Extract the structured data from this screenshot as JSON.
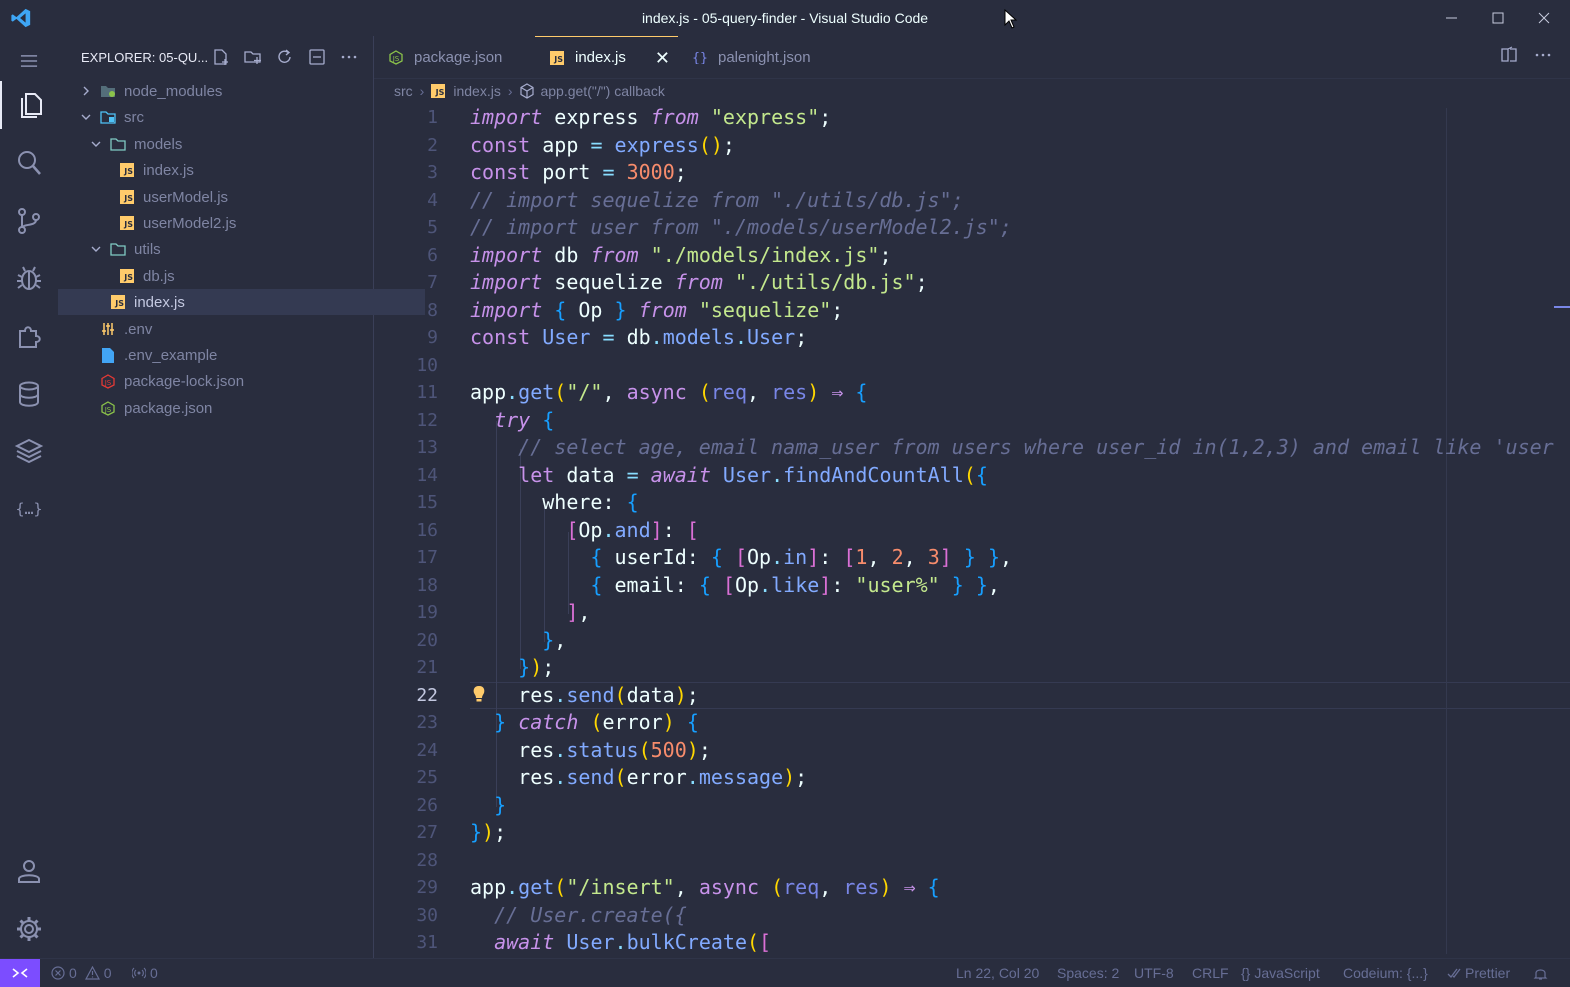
{
  "window": {
    "title": "index.js - 05-query-finder - Visual Studio Code"
  },
  "explorer": {
    "header": "EXPLORER: 05-QU...",
    "tree": [
      {
        "label": "node_modules",
        "kind": "folder",
        "expanded": false,
        "indent": 0
      },
      {
        "label": "src",
        "kind": "folder",
        "expanded": true,
        "indent": 0
      },
      {
        "label": "models",
        "kind": "folder",
        "expanded": true,
        "indent": 1
      },
      {
        "label": "index.js",
        "kind": "js",
        "indent": 2
      },
      {
        "label": "userModel.js",
        "kind": "js",
        "indent": 2
      },
      {
        "label": "userModel2.js",
        "kind": "js",
        "indent": 2
      },
      {
        "label": "utils",
        "kind": "folder",
        "expanded": true,
        "indent": 1
      },
      {
        "label": "db.js",
        "kind": "js",
        "indent": 2
      },
      {
        "label": "index.js",
        "kind": "js",
        "indent": 1,
        "selected": true
      },
      {
        "label": ".env",
        "kind": "env",
        "indent": 0
      },
      {
        "label": ".env_example",
        "kind": "file",
        "indent": 0
      },
      {
        "label": "package-lock.json",
        "kind": "npm",
        "indent": 0
      },
      {
        "label": "package.json",
        "kind": "nodejs",
        "indent": 0
      }
    ]
  },
  "tabs": [
    {
      "label": "package.json",
      "icon": "nodejs-icon"
    },
    {
      "label": "index.js",
      "icon": "js-icon",
      "active": true
    },
    {
      "label": "palenight.json",
      "icon": "braces-icon"
    }
  ],
  "breadcrumb": {
    "folder": "src",
    "file": "index.js",
    "symbol": "app.get(\"/\") callback"
  },
  "editor": {
    "current_line": 22,
    "line_numbers": [
      "1",
      "2",
      "3",
      "4",
      "5",
      "6",
      "7",
      "8",
      "9",
      "10",
      "11",
      "12",
      "13",
      "14",
      "15",
      "16",
      "17",
      "18",
      "19",
      "20",
      "21",
      "22",
      "23",
      "24",
      "25",
      "26",
      "27",
      "28",
      "29",
      "30",
      "31"
    ],
    "lines": [
      "import express from \"express\";",
      "const app = express();",
      "const port = 3000;",
      "// import sequelize from \"./utils/db.js\";",
      "// import user from \"./models/userModel2.js\";",
      "import db from \"./models/index.js\";",
      "import sequelize from \"./utils/db.js\";",
      "import { Op } from \"sequelize\";",
      "const User = db.models.User;",
      "",
      "app.get(\"/\", async (req, res) => {",
      "  try {",
      "    // select age, email nama_user from users where user_id in(1,2,3) and email like 'user",
      "    let data = await User.findAndCountAll({",
      "      where: {",
      "        [Op.and]: [",
      "          { userId: { [Op.in]: [1, 2, 3] } },",
      "          { email: { [Op.like]: \"user%\" } },",
      "        ],",
      "      },",
      "    });",
      "    res.send(data);",
      "  } catch (error) {",
      "    res.status(500);",
      "    res.send(error.message);",
      "  }",
      "});",
      "",
      "app.get(\"/insert\", async (req, res) => {",
      "  // User.create({",
      "  await User.bulkCreate(["
    ]
  },
  "status": {
    "errors": "0",
    "warnings": "0",
    "ports": "0",
    "position": "Ln 22, Col 20",
    "spaces": "Spaces: 2",
    "encoding": "UTF-8",
    "eol": "CRLF",
    "language": "JavaScript",
    "codeium": "Codeium: {...}",
    "prettier": "Prettier"
  },
  "colors": {
    "background": "#292d3e",
    "accent": "#7c4dff",
    "keyword": "#c792ea",
    "string": "#c3e88d",
    "number": "#f78c6c",
    "function": "#82aaff",
    "comment": "#676e95"
  }
}
